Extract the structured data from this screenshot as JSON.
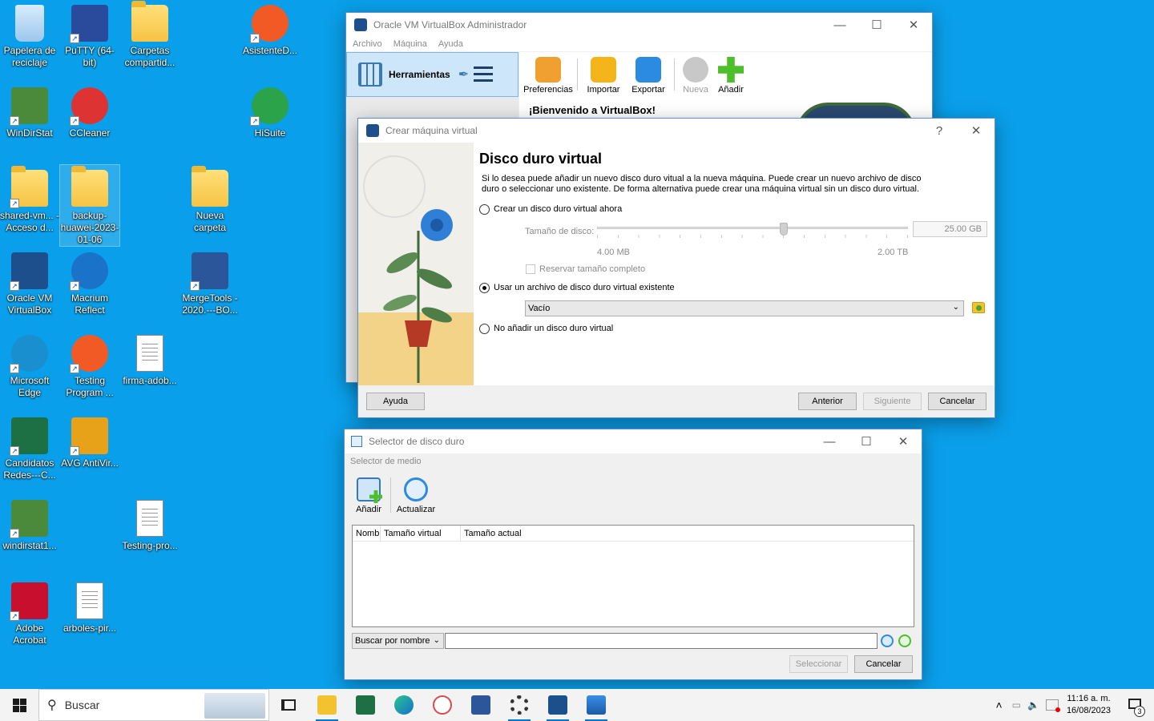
{
  "desktop": {
    "icons": [
      {
        "label": "Papelera de reciclaje"
      },
      {
        "label": "PuTTY (64-bit)"
      },
      {
        "label": "Carpetas compartid..."
      },
      {
        "label": "AsistenteD..."
      },
      {
        "label": "WinDirStat"
      },
      {
        "label": "CCleaner"
      },
      {
        "label": "HiSuite"
      },
      {
        "label": "shared-vm... - Acceso d..."
      },
      {
        "label": "backup-huawei-2023-01-06"
      },
      {
        "label": "Nueva carpeta"
      },
      {
        "label": "Oracle VM VirtualBox"
      },
      {
        "label": "Macrium Reflect"
      },
      {
        "label": "MergeTools - 2020.---BO..."
      },
      {
        "label": "Microsoft Edge"
      },
      {
        "label": "Testing Program ..."
      },
      {
        "label": "firma-adob..."
      },
      {
        "label": "Candidatos Redes---C..."
      },
      {
        "label": "AVG AntiVir..."
      },
      {
        "label": "windirstat1..."
      },
      {
        "label": "Testing-pro..."
      },
      {
        "label": "Adobe Acrobat"
      },
      {
        "label": "arboles-pir..."
      }
    ]
  },
  "vbox_manager": {
    "title": "Oracle VM VirtualBox Administrador",
    "menu": [
      "Archivo",
      "Máquina",
      "Ayuda"
    ],
    "tools_label": "Herramientas",
    "toolbar": [
      {
        "label": "Preferencias",
        "color": "#f0a030"
      },
      {
        "label": "Importar",
        "color": "#f5b41a"
      },
      {
        "label": "Exportar",
        "color": "#2b8be0"
      },
      {
        "label": "Nueva",
        "color": "#c8c8c8"
      },
      {
        "label": "Añadir",
        "color": "#4cbf2a"
      }
    ],
    "welcome": "¡Bienvenido a VirtualBox!"
  },
  "wizard": {
    "title": "Crear máquina virtual",
    "help_glyph": "?",
    "heading": "Disco duro virtual",
    "description_line1": "Si lo desea puede añadir un nuevo disco duro vitual a la nueva máquina. Puede crear un nuevo archivo de disco",
    "description_line2": "duro o seleccionar uno existente. De forma alternativa puede crear una máquina virtual sin un disco duro virtual.",
    "option_create": "Crear un disco duro virtual ahora",
    "disk_size_label": "Tamaño de disco:",
    "disk_size_value": "25.00 GB",
    "size_min": "4.00 MB",
    "size_max": "2.00 TB",
    "slider_level": 0.6,
    "reserve_label": "Reservar tamaño completo",
    "option_existing": "Usar un archivo de disco duro virtual existente",
    "existing_value": "Vacío",
    "option_none": "No añadir un disco duro virtual",
    "selected_option": "existing",
    "buttons": {
      "help": "Ayuda",
      "back": "Anterior",
      "next": "Siguiente",
      "cancel": "Cancelar"
    }
  },
  "selector": {
    "title": "Selector de disco duro",
    "subtitle": "Selector de medio",
    "add_label": "Añadir",
    "refresh_label": "Actualizar",
    "columns": [
      "Nomb",
      "Tamaño virtual",
      "Tamaño actual"
    ],
    "search_mode": "Buscar por nombre",
    "search_value": "",
    "buttons": {
      "select": "Seleccionar",
      "cancel": "Cancelar"
    }
  },
  "taskbar": {
    "search_placeholder": "Buscar",
    "time": "11:16 a. m.",
    "date": "16/08/2023",
    "notification_count": "3"
  }
}
